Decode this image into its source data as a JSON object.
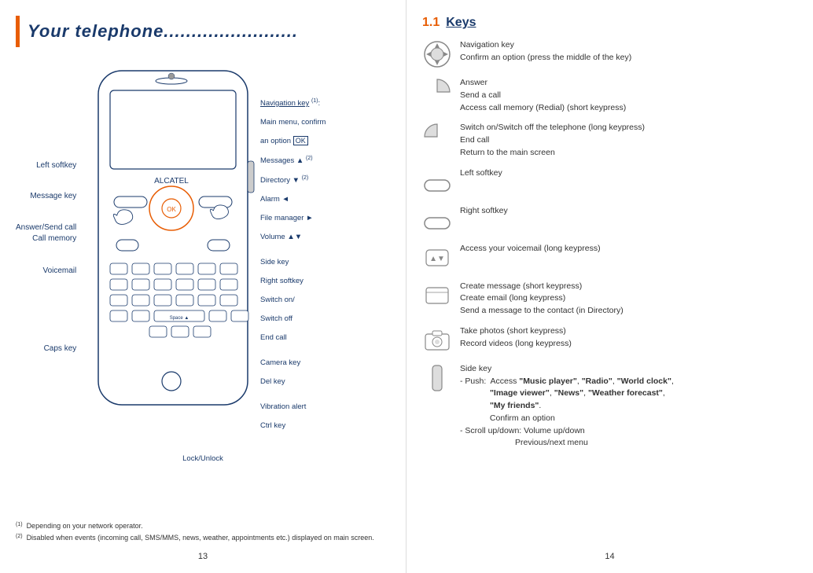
{
  "left_page": {
    "title": "Your telephone........................",
    "left_labels": [
      "Left softkey",
      "Message key",
      "Answer/Send call\nCall memory",
      "Voicemail",
      "Caps key"
    ],
    "right_labels": [
      {
        "text": "Navigation key",
        "superscript": "(1)",
        "suffix": ":",
        "underline": true
      },
      {
        "text": "Main menu, confirm"
      },
      {
        "text": "an option OK"
      },
      {
        "text": "Messages ▲",
        "superscript": "(2)"
      },
      {
        "text": "Directory ▼",
        "superscript": "(2)"
      },
      {
        "text": "Alarm ◄"
      },
      {
        "text": "File manager ►"
      },
      {
        "text": "Volume ▲▼"
      },
      {
        "text": "Side key"
      },
      {
        "text": "Right softkey"
      },
      {
        "text": "Switch on/"
      },
      {
        "text": "Switch off"
      },
      {
        "text": "End call"
      },
      {
        "text": "Camera key"
      },
      {
        "text": "Del key"
      },
      {
        "text": "Vibration alert"
      },
      {
        "text": "Ctrl key"
      }
    ],
    "bottom_label": "Lock/Unlock",
    "footnotes": [
      {
        "sup": "(1)",
        "text": "Depending on your network operator."
      },
      {
        "sup": "(2)",
        "text": "Disabled when events (incoming call, SMS/MMS, news, weather, appointments etc.) displayed on main screen."
      }
    ],
    "page_number": "13"
  },
  "right_page": {
    "section_number": "1.1",
    "section_title": "Keys",
    "keys": [
      {
        "icon_type": "nav_circle",
        "lines": [
          "Navigation key",
          "Confirm an option (press the middle of the key)"
        ]
      },
      {
        "icon_type": "half_circle_right",
        "lines": [
          "Answer",
          "Send a call",
          "Access call memory (Redial) (short keypress)"
        ]
      },
      {
        "icon_type": "half_circle_left",
        "lines": [
          "Switch on/Switch off the telephone (long keypress)",
          "End call",
          "Return to the main screen"
        ]
      },
      {
        "icon_type": "rect_left",
        "lines": [
          "Left softkey"
        ]
      },
      {
        "icon_type": "rect_right",
        "lines": [
          "Right softkey"
        ]
      },
      {
        "icon_type": "voicemail",
        "lines": [
          "Access your voicemail (long keypress)"
        ]
      },
      {
        "icon_type": "message",
        "lines": [
          "Create message (short keypress)",
          "Create email (long keypress)",
          "Send a message to the contact (in Directory)"
        ]
      },
      {
        "icon_type": "camera",
        "lines": [
          "Take photos (short keypress)",
          "Record videos (long keypress)"
        ]
      },
      {
        "icon_type": "side_key",
        "lines": [
          "Side key",
          "- Push:  Access \"Music player\", \"Radio\", \"World clock\",",
          "             \"Image viewer\", \"News\", \"Weather forecast\",",
          "             \"My friends\".",
          "             Confirm an option",
          "- Scroll up/down: Volume up/down",
          "                        Previous/next menu"
        ],
        "bold_parts": [
          "\"Music player\"",
          "\"Radio\"",
          "\"World clock\"",
          "\"Image viewer\"",
          "\"News\"",
          "\"Weather forecast\"",
          "\"My friends\""
        ]
      }
    ],
    "page_number": "14"
  }
}
